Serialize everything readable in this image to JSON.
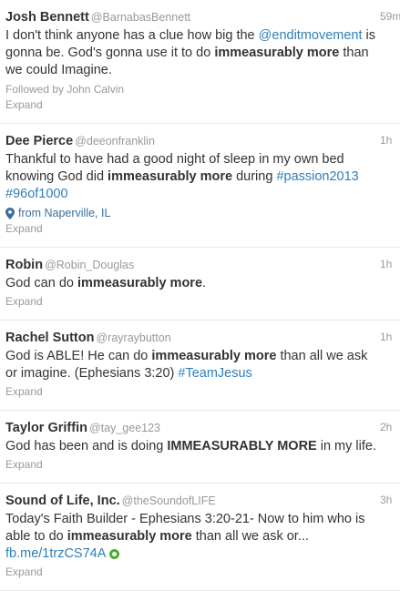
{
  "tweets": [
    {
      "fullname": "Josh Bennett",
      "screenname": "@BarnabasBennett",
      "time": "59m",
      "segments": [
        {
          "t": "I don't think anyone has a clue how big the "
        },
        {
          "t": "@enditmovement",
          "link": true
        },
        {
          "t": " is gonna be. God's gonna use it to do "
        },
        {
          "t": "immeasurably more",
          "bold": true
        },
        {
          "t": " than we could Imagine."
        }
      ],
      "context": "Followed by John Calvin",
      "expand": "Expand"
    },
    {
      "fullname": "Dee Pierce",
      "screenname": "@deeonfranklin",
      "time": "1h",
      "segments": [
        {
          "t": "Thankful to have had a good night of sleep in my own bed knowing God did "
        },
        {
          "t": "immeasurably more",
          "bold": true
        },
        {
          "t": " during "
        },
        {
          "t": "#passion2013",
          "link": true
        },
        {
          "t": " "
        },
        {
          "t": "#96of1000",
          "link": true
        }
      ],
      "place": "from Naperville, IL",
      "expand": "Expand"
    },
    {
      "fullname": "Robin",
      "screenname": "@Robin_Douglas",
      "time": "1h",
      "segments": [
        {
          "t": "God can do "
        },
        {
          "t": "immeasurably more",
          "bold": true
        },
        {
          "t": "."
        }
      ],
      "expand": "Expand"
    },
    {
      "fullname": "Rachel Sutton",
      "screenname": "@rayraybutton",
      "time": "1h",
      "segments": [
        {
          "t": "God is ABLE! He can do "
        },
        {
          "t": "immeasurably more",
          "bold": true
        },
        {
          "t": " than all we ask or imagine. (Ephesians 3:20) "
        },
        {
          "t": "#TeamJesus",
          "link": true
        }
      ],
      "expand": "Expand"
    },
    {
      "fullname": "Taylor Griffin",
      "screenname": "@tay_gee123",
      "time": "2h",
      "segments": [
        {
          "t": "God has been and is doing "
        },
        {
          "t": "IMMEASURABLY MORE",
          "bold": true
        },
        {
          "t": " in my life."
        }
      ],
      "expand": "Expand"
    },
    {
      "fullname": "Sound of Life, Inc.",
      "screenname": "@theSoundofLIFE",
      "time": "3h",
      "segments": [
        {
          "t": "Today's Faith Builder - Ephesians 3:20-21- Now to him who is able to do "
        },
        {
          "t": "immeasurably more",
          "bold": true
        },
        {
          "t": " than all we ask or... "
        },
        {
          "t": "fb.me/1trzCS74A",
          "link": true
        }
      ],
      "icon": "facebook-app-icon",
      "expand": "Expand"
    }
  ]
}
